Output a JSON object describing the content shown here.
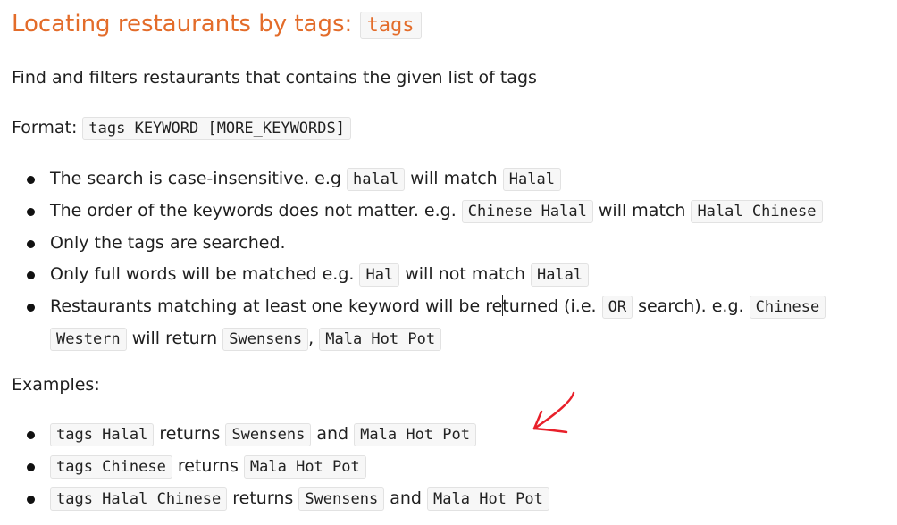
{
  "heading": {
    "text": "Locating restaurants by tags: ",
    "code": "tags"
  },
  "description": "Find and filters restaurants that contains the given list of tags",
  "format": {
    "label": "Format: ",
    "code": "tags KEYWORD [MORE_KEYWORDS]"
  },
  "notes": {
    "n1": {
      "t1": "The search is case-insensitive. e.g ",
      "c1": "halal",
      "t2": " will match ",
      "c2": "Halal"
    },
    "n2": {
      "t1": "The order of the keywords does not matter. e.g. ",
      "c1": "Chinese Halal",
      "t2": " will match ",
      "c2": "Halal Chinese"
    },
    "n3": {
      "t1": "Only the tags are searched."
    },
    "n4": {
      "t1": "Only full words will be matched e.g. ",
      "c1": "Hal",
      "t2": " will not match ",
      "c2": "Halal"
    },
    "n5": {
      "t1a": "Restaurants matching at least one keyword will be re",
      "t1b": "turned (i.e. ",
      "c1": "OR",
      "t2": " search). e.g. ",
      "c2": "Chinese",
      "c3": "Western",
      "t3": " will return ",
      "c4": "Swensens",
      "t4": ", ",
      "c5": "Mala Hot Pot"
    }
  },
  "examples_label": "Examples:",
  "examples": {
    "e1": {
      "c1": "tags Halal",
      "t1": " returns ",
      "c2": "Swensens",
      "t2": " and ",
      "c3": "Mala Hot Pot"
    },
    "e2": {
      "c1": "tags Chinese",
      "t1": " returns ",
      "c2": "Mala Hot Pot"
    },
    "e3": {
      "c1": "tags Halal Chinese",
      "t1": " returns ",
      "c2": "Swensens",
      "t2": " and ",
      "c3": "Mala Hot Pot"
    }
  },
  "annotation": {
    "arrow_color": "#e8202a",
    "arrow_icon": "red-arrow-icon"
  }
}
